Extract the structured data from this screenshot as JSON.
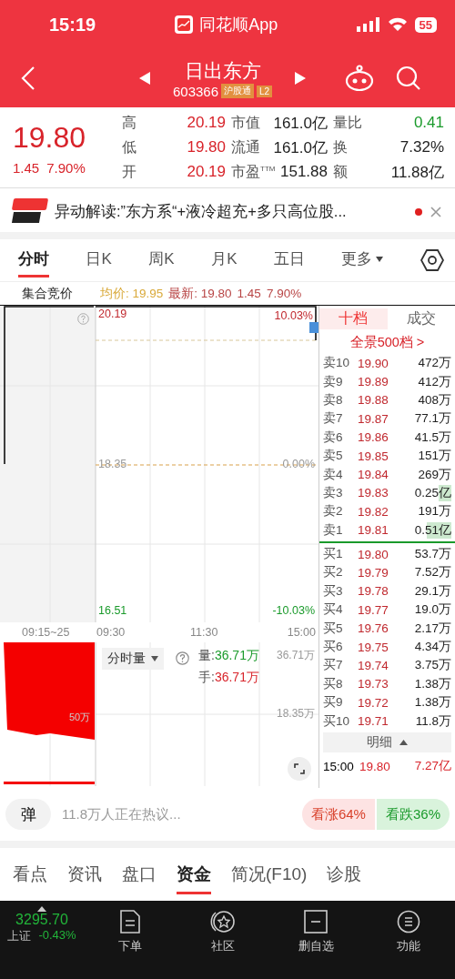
{
  "status_bar": {
    "time": "15:19",
    "app_name": "同花顺App",
    "battery": "55"
  },
  "header": {
    "name": "日出东方",
    "code": "603366",
    "badges": [
      "沪股通",
      "L2"
    ]
  },
  "quote": {
    "price": "19.80",
    "change": "1.45",
    "change_pct": "7.90%",
    "stats": [
      {
        "label": "高",
        "value": "20.19",
        "color": "#d8232a"
      },
      {
        "label": "市值",
        "value": "161.0亿",
        "color": "#222222"
      },
      {
        "label": "量比",
        "value": "0.41",
        "color": "#1a9a2b"
      },
      {
        "label": "低",
        "value": "19.80",
        "color": "#d8232a"
      },
      {
        "label": "流通",
        "value": "161.0亿",
        "color": "#222222"
      },
      {
        "label": "换",
        "value": "7.32%",
        "color": "#222222"
      },
      {
        "label": "开",
        "value": "20.19",
        "color": "#d8232a"
      },
      {
        "label": "市盈$^{TTM}$",
        "value": "151.88",
        "color": "#222222"
      },
      {
        "label": "额",
        "value": "11.88亿",
        "color": "#222222"
      }
    ]
  },
  "news": {
    "text": "异动解读:”东方系“+液冷超充+多只高位股...",
    "unread": true
  },
  "chart_tabs": [
    {
      "label": "分时",
      "selected": true,
      "kind": "plain"
    },
    {
      "label": "日K",
      "selected": false,
      "kind": "plain"
    },
    {
      "label": "周K",
      "selected": false,
      "kind": "plain"
    },
    {
      "label": "月K",
      "selected": false,
      "kind": "plain"
    },
    {
      "label": "五日",
      "selected": false,
      "kind": "plain"
    },
    {
      "label": "更多",
      "selected": false,
      "kind": "dropdown"
    }
  ],
  "chart_header": {
    "auction": "集合竞价",
    "average": "均价: 19.95",
    "latest": "最新: 19.80",
    "change": "1.45",
    "change_pct": "7.90%"
  },
  "chart": {
    "high": "20.19",
    "high_pct": "10.03%",
    "base": "18.35",
    "base_pct": "0.00%",
    "low": "16.51",
    "low_pct": "-10.03%",
    "times": [
      "09:15~25",
      "09:30",
      "11:30",
      "15:00"
    ],
    "volume_selector": "分时量",
    "volume_label": "量:",
    "volume_value": "36.71万",
    "hand_label": "手:",
    "hand_value": "36.71万",
    "volume_max": "36.71万",
    "volume_mid": "18.35万",
    "auction_volume": "50万"
  },
  "order_book": {
    "tabs": [
      {
        "label": "十档",
        "selected": true
      },
      {
        "label": "成交",
        "selected": false
      }
    ],
    "depth_link": "全景500档 >",
    "asks": [
      {
        "label": "卖10",
        "price": "19.90",
        "volume": "472万"
      },
      {
        "label": "卖9",
        "price": "19.89",
        "volume": "412万"
      },
      {
        "label": "卖8",
        "price": "19.88",
        "volume": "408万"
      },
      {
        "label": "卖7",
        "price": "19.87",
        "volume": "77.1万"
      },
      {
        "label": "卖6",
        "price": "19.86",
        "volume": "41.5万"
      },
      {
        "label": "卖5",
        "price": "19.85",
        "volume": "151万"
      },
      {
        "label": "卖4",
        "price": "19.84",
        "volume": "269万"
      },
      {
        "label": "卖3",
        "price": "19.83",
        "volume": "0.25亿",
        "level": 0.25
      },
      {
        "label": "卖2",
        "price": "19.82",
        "volume": "191万"
      },
      {
        "label": "卖1",
        "price": "19.81",
        "volume": "0.51亿",
        "level": 0.5
      }
    ],
    "bids": [
      {
        "label": "买1",
        "price": "19.80",
        "volume": "53.7万"
      },
      {
        "label": "买2",
        "price": "19.79",
        "volume": "7.52万"
      },
      {
        "label": "买3",
        "price": "19.78",
        "volume": "29.1万"
      },
      {
        "label": "买4",
        "price": "19.77",
        "volume": "19.0万"
      },
      {
        "label": "买5",
        "price": "19.76",
        "volume": "2.17万"
      },
      {
        "label": "买6",
        "price": "19.75",
        "volume": "4.34万"
      },
      {
        "label": "买7",
        "price": "19.74",
        "volume": "3.75万"
      },
      {
        "label": "买8",
        "price": "19.73",
        "volume": "1.38万"
      },
      {
        "label": "买9",
        "price": "19.72",
        "volume": "1.38万"
      },
      {
        "label": "买10",
        "price": "19.71",
        "volume": "11.8万"
      }
    ],
    "detail_button": "明细",
    "trade": {
      "time": "15:00",
      "price": "19.80",
      "amount": "7.27亿"
    }
  },
  "social": {
    "barrage": "弹",
    "text": "11.8万人正在热议...",
    "bull": "看涨64%",
    "bear": "看跌36%"
  },
  "bottom_tabs": [
    {
      "label": "看点",
      "selected": false
    },
    {
      "label": "资讯",
      "selected": false
    },
    {
      "label": "盘口",
      "selected": false
    },
    {
      "label": "资金",
      "selected": true
    },
    {
      "label": "简况(F10)",
      "selected": false
    },
    {
      "label": "诊股",
      "selected": false
    }
  ],
  "bottom_nav": {
    "index_value": "3295.70",
    "index_name": "上证",
    "index_change": "-0.43%",
    "items": [
      {
        "label": "下单",
        "kind": "order"
      },
      {
        "label": "社区",
        "kind": "community"
      },
      {
        "label": "删自选",
        "kind": "remove"
      },
      {
        "label": "功能",
        "kind": "menu"
      }
    ]
  }
}
